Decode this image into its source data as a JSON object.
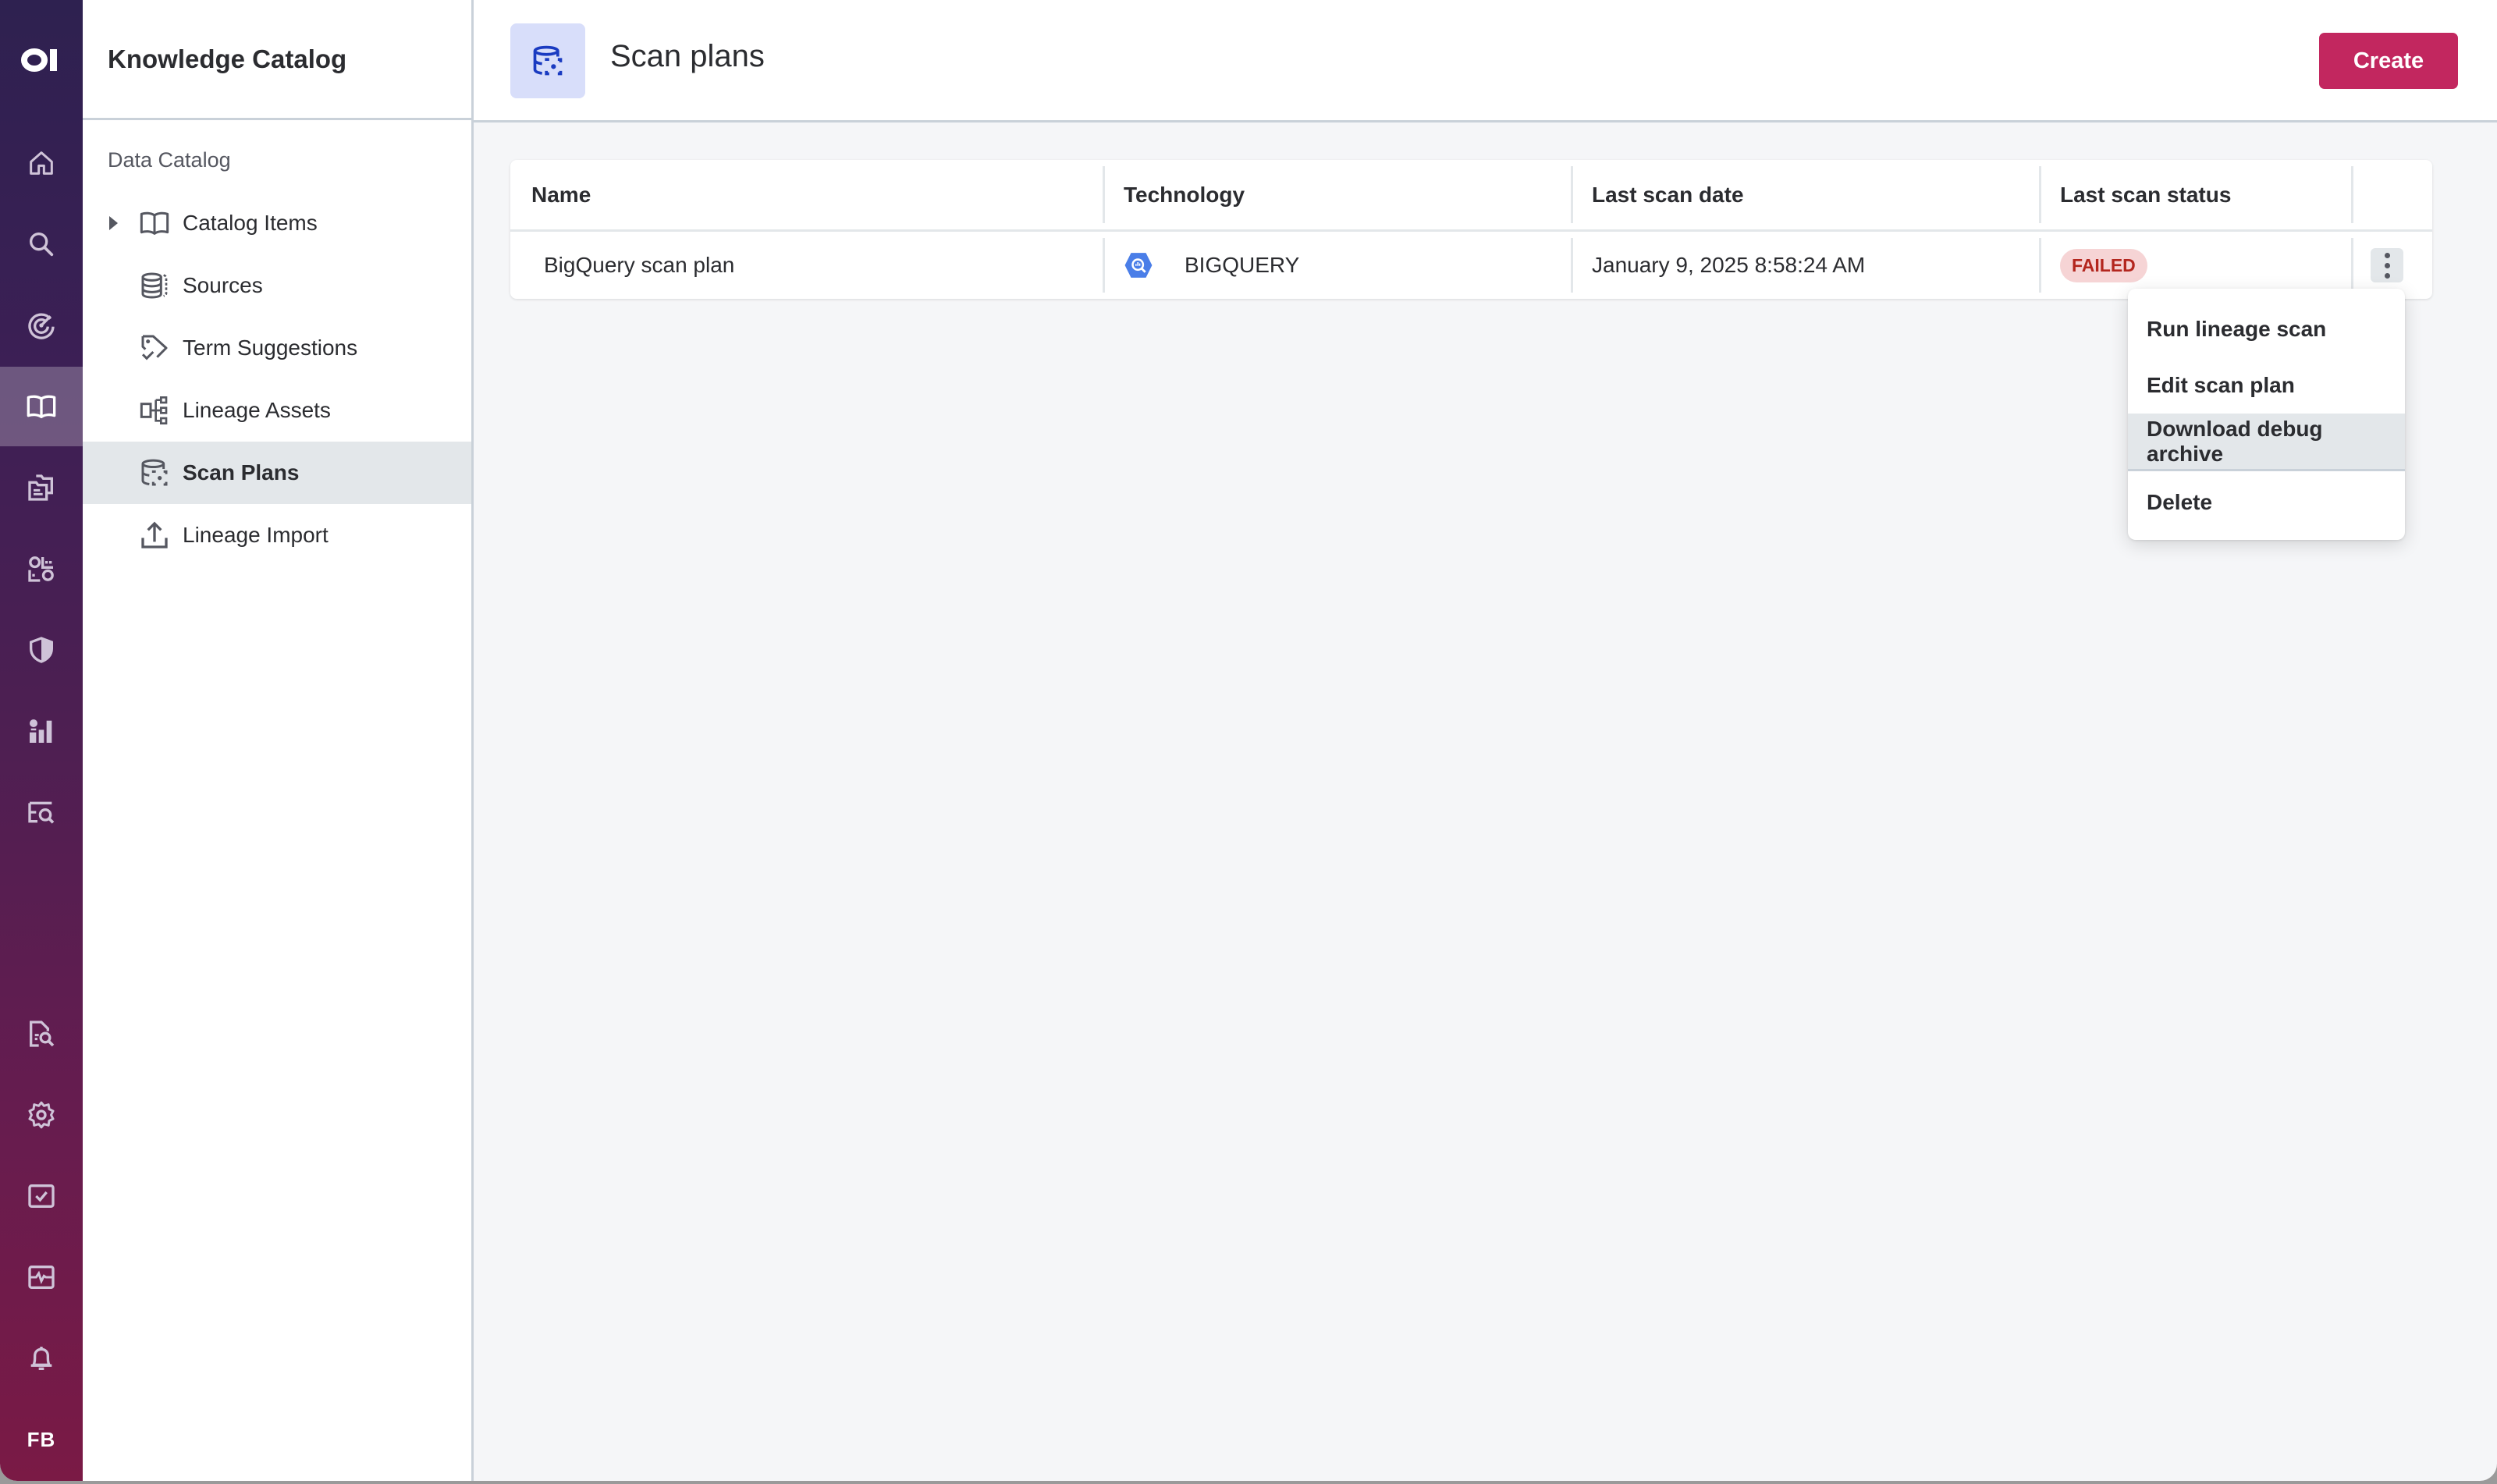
{
  "rail": {
    "logo": "OI",
    "items": [
      {
        "icon": "home-icon",
        "label": "Home"
      },
      {
        "icon": "search-icon",
        "label": "Search"
      },
      {
        "icon": "radar-icon",
        "label": "Discovery"
      },
      {
        "icon": "book-icon",
        "label": "Knowledge Catalog",
        "active": true
      },
      {
        "icon": "folders-icon",
        "label": "Folders"
      },
      {
        "icon": "data-quality-icon",
        "label": "Data Quality"
      },
      {
        "icon": "shield-icon",
        "label": "Governance"
      },
      {
        "icon": "insights-icon",
        "label": "Insights"
      },
      {
        "icon": "query-icon",
        "label": "Query"
      },
      {
        "icon": "doc-search-icon",
        "label": "Monitoring"
      },
      {
        "icon": "gear-icon",
        "label": "Settings"
      },
      {
        "icon": "checkbox-icon",
        "label": "Tasks"
      },
      {
        "icon": "pulse-icon",
        "label": "Health"
      },
      {
        "icon": "bell-icon",
        "label": "Notifications"
      }
    ],
    "avatar": "FB"
  },
  "subnav": {
    "title": "Knowledge Catalog",
    "section": "Data Catalog",
    "items": [
      {
        "label": "Catalog Items",
        "icon": "book-icon",
        "expandable": true
      },
      {
        "label": "Sources",
        "icon": "database-icon"
      },
      {
        "label": "Term Suggestions",
        "icon": "tag-check-icon"
      },
      {
        "label": "Lineage Assets",
        "icon": "lineage-icon"
      },
      {
        "label": "Scan Plans",
        "icon": "scan-plan-icon",
        "active": true
      },
      {
        "label": "Lineage Import",
        "icon": "upload-icon"
      }
    ]
  },
  "header": {
    "title": "Scan plans",
    "create_label": "Create"
  },
  "table": {
    "columns": [
      "Name",
      "Technology",
      "Last scan date",
      "Last scan status",
      ""
    ],
    "rows": [
      {
        "name": "BigQuery scan plan",
        "technology": "BIGQUERY",
        "last_scan_date": "January 9, 2025 8:58:24 AM",
        "last_scan_status": "FAILED"
      }
    ]
  },
  "row_menu": {
    "items": [
      "Run lineage scan",
      "Edit scan plan",
      "Download debug archive",
      "Delete"
    ],
    "hovered": "Download debug archive"
  },
  "colors": {
    "accent": "#c2275f",
    "status_failed_bg": "#f6d4d5",
    "status_failed_text": "#b3261e",
    "page_icon_bg": "#d8defa",
    "page_icon_fg": "#1a3bc1",
    "bigquery_blue": "#4a7ee8"
  }
}
